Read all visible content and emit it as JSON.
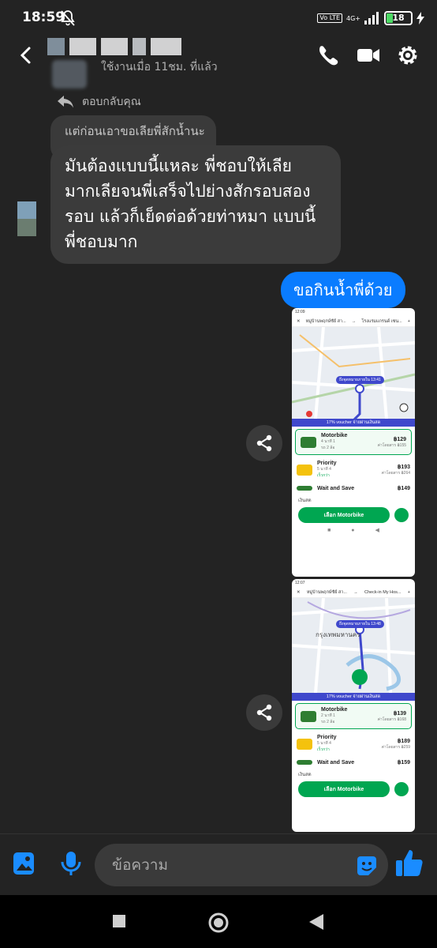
{
  "status_bar": {
    "time": "18:59",
    "network": "4G+",
    "volte": "Vo LTE",
    "battery": "18"
  },
  "header": {
    "activity": "ใช้งานเมื่อ 11ชม. ที่แล้ว"
  },
  "reply": {
    "label": "ตอบกลับคุณ",
    "quoted_text": "แต่ก่อนเอาขอเลียพี่สักน้ำนะ"
  },
  "incoming_message": {
    "lines": [
      "มันต้องแบบนี้แหละ พี่ชอบให้เลีย",
      "มากเลียจนพี่เสร็จไปย่างสักรอบสอง",
      "รอบ  แล้วก็เย็ดต่อด้วยท่าหมา แบบนี้",
      "พี่ชอบมาก"
    ]
  },
  "outgoing_message": {
    "text": "ขอกินน้ำพี่ด้วย"
  },
  "screenshots": [
    {
      "time": "12:09",
      "from": "หมู่บ้านพฤกษ์ชัย์ สา...",
      "to": "โรงแรมแกรนด์ เซน...",
      "map_label": "ถึงจุดหมายภายใน 13:41",
      "voucher": "17% voucher จ่ายผ่านเงินสด",
      "rides": [
        {
          "name": "Motorbike",
          "meta": "4 นาที  1",
          "extra": "รถ 2 ล้อ",
          "price": "฿129",
          "old": "ค่าโดยสาร ฿155"
        },
        {
          "name": "Priority",
          "meta": "5 นาที  4",
          "extra": "เร็วกว่า",
          "price": "฿193",
          "old": "ค่าโดยสาร ฿264"
        },
        {
          "name": "Wait and Save",
          "meta": "",
          "extra": "",
          "price": "฿149",
          "old": ""
        }
      ],
      "payment": "เงินสด",
      "book_label": "เลือก Motorbike"
    },
    {
      "time": "12:07",
      "from": "หมู่บ้านพฤกษ์ชัย์ สา...",
      "to": "Check-in My Hos...",
      "map_label": "ถึงจุดหมายภายใน 13:48",
      "map_city": "กรุงเทพมหานคร",
      "voucher": "17% voucher จ่ายผ่านเงินสด",
      "rides": [
        {
          "name": "Motorbike",
          "meta": "2 นาที  1",
          "extra": "รถ 2 ล้อ",
          "price": "฿139",
          "old": "ค่าโดยสาร ฿168"
        },
        {
          "name": "Priority",
          "meta": "5 นาที  4",
          "extra": "เร็วกว่า",
          "price": "฿189",
          "old": "ค่าโดยสาร ฿259"
        },
        {
          "name": "Wait and Save",
          "meta": "",
          "extra": "",
          "price": "฿159",
          "old": ""
        }
      ],
      "payment": "เงินสด",
      "book_label": "เลือก Motorbike"
    }
  ],
  "composer": {
    "placeholder": "ข้อความ"
  },
  "colors": {
    "outgoing": "#0a7cff",
    "icon_blue": "#1a8cff",
    "ride_green": "#00a651"
  }
}
